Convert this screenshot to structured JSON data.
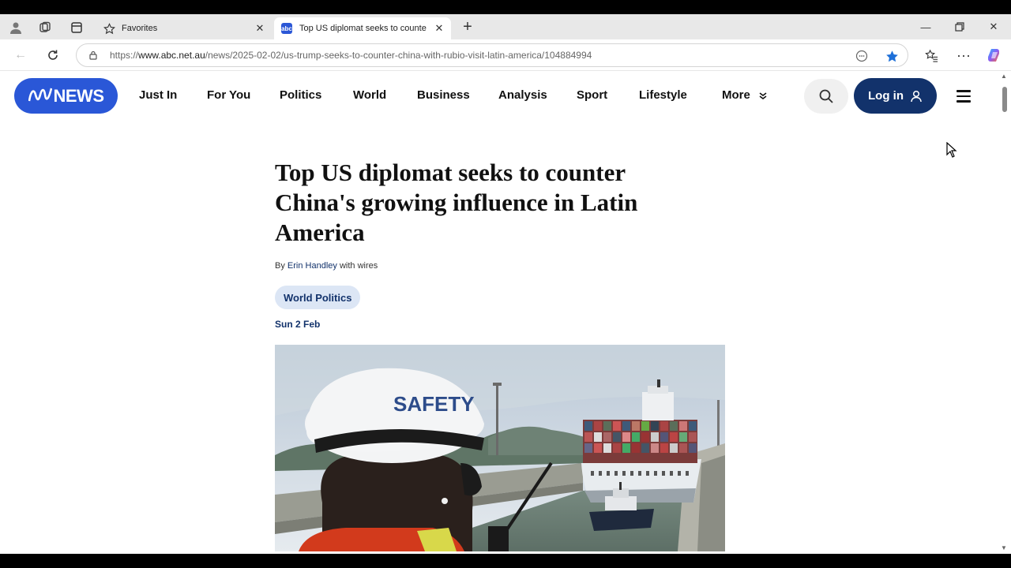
{
  "browser": {
    "tabs": [
      {
        "title": "Favorites",
        "active": false
      },
      {
        "title": "Top US diplomat seeks to counte",
        "active": true
      }
    ],
    "address": {
      "url_prefix": "https://",
      "url_domain": "www.abc.net.au",
      "url_path": "/news/2025-02-02/us-trump-seeks-to-counter-china-with-rubio-visit-latin-america/104884994"
    },
    "favicon_text": "abc"
  },
  "site": {
    "logo_text": "NEWS",
    "nav": [
      "Just In",
      "For You",
      "Politics",
      "World",
      "Business",
      "Analysis",
      "Sport",
      "Lifestyle",
      "More"
    ],
    "login_label": "Log in"
  },
  "article": {
    "headline": "Top US diplomat seeks to counter China's growing influence in Latin America",
    "byline_prefix": "By",
    "author": "Erin Handley",
    "byline_suffix": "with wires",
    "tag": "World Politics",
    "date": "Sun 2 Feb",
    "image_helmet_text": "SAFETY"
  },
  "colors": {
    "brand_blue": "#2a57d7",
    "navy": "#12326b",
    "tag_bg": "#dce6f5"
  }
}
